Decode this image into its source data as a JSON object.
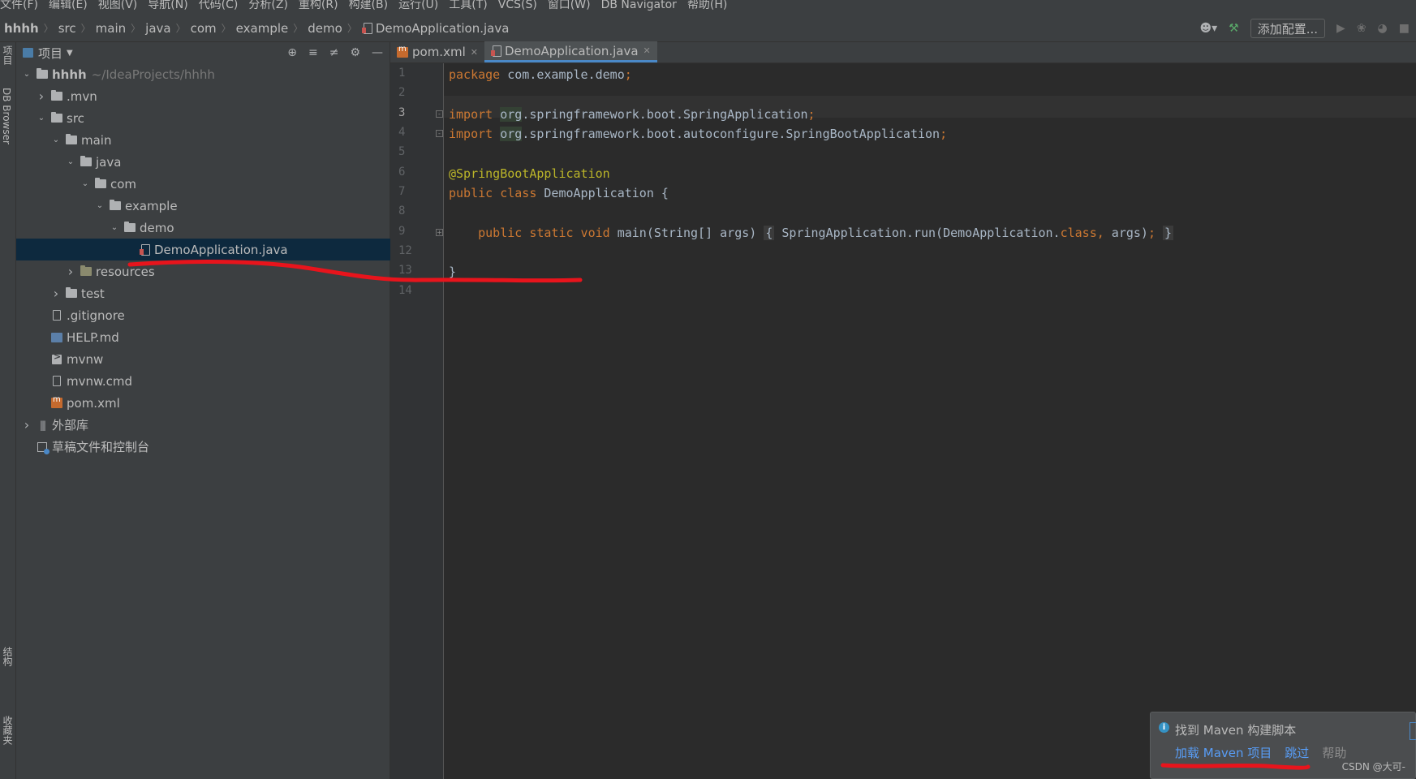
{
  "menubar": {
    "items": [
      "文件(F)",
      "编辑(E)",
      "视图(V)",
      "导航(N)",
      "代码(C)",
      "分析(Z)",
      "重构(R)",
      "构建(B)",
      "运行(U)",
      "工具(T)",
      "VCS(S)",
      "窗口(W)",
      "DB Navigator",
      "帮助(H)"
    ]
  },
  "breadcrumb": [
    "hhhh",
    "src",
    "main",
    "java",
    "com",
    "example",
    "demo",
    "DemoApplication.java"
  ],
  "toolbar": {
    "add_config_label": "添加配置..."
  },
  "leftstrip": {
    "project_label": "项目",
    "db_browser_label": "DB Browser",
    "structure_label": "结构",
    "favorites_label": "收藏夹"
  },
  "project_panel": {
    "title": "项目",
    "tree": [
      {
        "label": "hhhh",
        "path": "~/IdeaProjects/hhhh",
        "icon": "folder-icon",
        "arrow": "down",
        "level": 0
      },
      {
        "label": ".mvn",
        "icon": "folder-icon",
        "arrow": "right",
        "level": 1
      },
      {
        "label": "src",
        "icon": "folder-icon",
        "arrow": "down",
        "level": 1
      },
      {
        "label": "main",
        "icon": "folder-icon",
        "arrow": "down",
        "level": 2
      },
      {
        "label": "java",
        "icon": "folder-icon",
        "arrow": "down",
        "level": 3
      },
      {
        "label": "com",
        "icon": "folder-icon",
        "arrow": "down",
        "level": 4
      },
      {
        "label": "example",
        "icon": "folder-icon",
        "arrow": "down",
        "level": 5
      },
      {
        "label": "demo",
        "icon": "folder-icon",
        "arrow": "down",
        "level": 6
      },
      {
        "label": "DemoApplication.java",
        "icon": "java-file-icon",
        "arrow": "",
        "level": 7,
        "selected": true
      },
      {
        "label": "resources",
        "icon": "folder-icon",
        "arrow": "right",
        "level": 3
      },
      {
        "label": "test",
        "icon": "folder-icon",
        "arrow": "right",
        "level": 2
      },
      {
        "label": ".gitignore",
        "icon": "file-icon",
        "arrow": "",
        "level": 1
      },
      {
        "label": "HELP.md",
        "icon": "markdown-icon",
        "arrow": "",
        "level": 1
      },
      {
        "label": "mvnw",
        "icon": "shell-icon",
        "arrow": "",
        "level": 1
      },
      {
        "label": "mvnw.cmd",
        "icon": "file-icon",
        "arrow": "",
        "level": 1
      },
      {
        "label": "pom.xml",
        "icon": "maven-icon",
        "arrow": "",
        "level": 1
      },
      {
        "label": "外部库",
        "icon": "library-icon",
        "arrow": "right",
        "level": 0
      },
      {
        "label": "草稿文件和控制台",
        "icon": "scratch-icon",
        "arrow": "",
        "level": 0
      }
    ]
  },
  "editor": {
    "tabs": [
      {
        "label": "pom.xml",
        "active": false
      },
      {
        "label": "DemoApplication.java",
        "active": true
      }
    ],
    "line_numbers": [
      "1",
      "2",
      "3",
      "4",
      "5",
      "6",
      "7",
      "8",
      "9",
      "12",
      "13",
      "14"
    ],
    "current_line": "3",
    "code": {
      "l1_kw": "package",
      "l1_rest": " com.example.demo",
      "semi": ";",
      "l3_kw": "import",
      "l3_pkg": "org",
      "l3_rest": ".springframework.boot.SpringApplication",
      "l4_kw": "import",
      "l4_pkg": "org",
      "l4_rest": ".springframework.boot.autoconfigure.SpringBootApplication",
      "l6_ann": "@SpringBootApplication",
      "l7_kw": "public class",
      "l7_rest": " DemoApplication {",
      "l9_kw": "public static void",
      "l9_rest": " main(String[] args)",
      "l9_open": "{",
      "l9_body": " SpringApplication.run(DemoApplication.",
      "l9_class": "class",
      "l9_comma": ",",
      "l9_args": " args)",
      "l9_close": "}",
      "l13": "}"
    }
  },
  "notification": {
    "message": "找到 Maven 构建脚本",
    "action_load": "加载 Maven 项目",
    "action_skip": "跳过",
    "action_help": "帮助",
    "watermark": "CSDN @大可-"
  },
  "colors": {
    "annotation_red": "#e8141c",
    "link_blue": "#589df6",
    "selection": "#0d293e"
  }
}
